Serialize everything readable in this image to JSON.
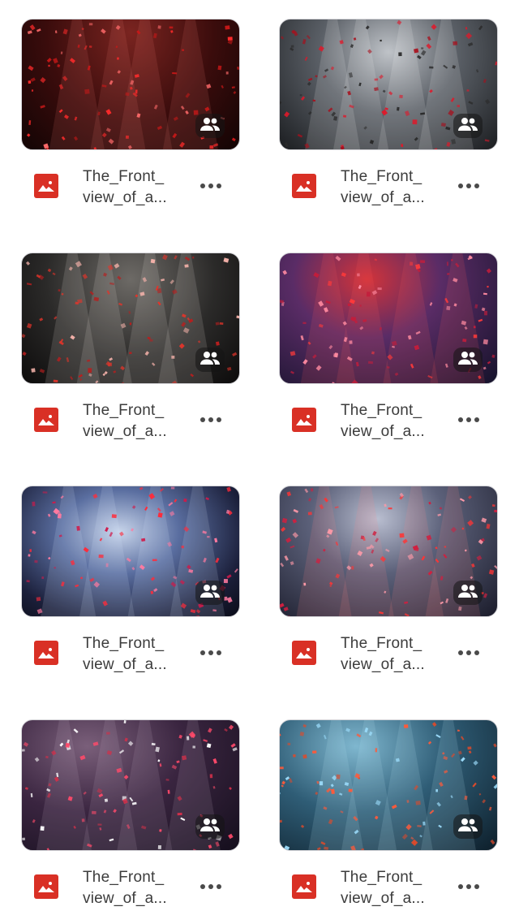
{
  "files": [
    {
      "name_line1": "The_Front_",
      "name_line2": "view_of_a...",
      "file_type_icon": "image-icon",
      "shared_icon": "people-icon",
      "more_icon": "more-horizontal-icon",
      "thumb_bg": "radial-gradient(ellipse at 50% 10%, #7a2420 0%, #3a0c0c 55%, #120404 100%)",
      "beam": "#e87a70",
      "confetti": [
        "#ff2b2b",
        "#c81818",
        "#ff6a6a"
      ]
    },
    {
      "name_line1": "The_Front_",
      "name_line2": "view_of_a...",
      "file_type_icon": "image-icon",
      "shared_icon": "people-icon",
      "more_icon": "more-horizontal-icon",
      "thumb_bg": "radial-gradient(ellipse at 50% 25%, #bfc3c8 0%, #5a5f66 45%, #1b1d20 100%)",
      "beam": "#ffffff",
      "confetti": [
        "#e0182a",
        "#a80f1c",
        "#2a2a2a"
      ]
    },
    {
      "name_line1": "The_Front_",
      "name_line2": "view_of_a...",
      "file_type_icon": "image-icon",
      "shared_icon": "people-icon",
      "more_icon": "more-horizontal-icon",
      "thumb_bg": "radial-gradient(ellipse at 50% 20%, #6d6a66 0%, #2b2a29 55%, #0c0b0b 100%)",
      "beam": "#f4ede5",
      "confetti": [
        "#e3342a",
        "#b81e1e",
        "#f2b0a8"
      ]
    },
    {
      "name_line1": "The_Front_",
      "name_line2": "view_of_a...",
      "file_type_icon": "image-icon",
      "shared_icon": "people-icon",
      "more_icon": "more-horizontal-icon",
      "thumb_bg": "radial-gradient(ellipse at 40% 20%, #d2333a 0%, #5a2c66 40%, #14122a 100%)",
      "beam": "#ff5a5a",
      "confetti": [
        "#ff3a3a",
        "#c41d3b",
        "#ff8aa0"
      ]
    },
    {
      "name_line1": "The_Front_",
      "name_line2": "view_of_a...",
      "file_type_icon": "image-icon",
      "shared_icon": "people-icon",
      "more_icon": "more-horizontal-icon",
      "thumb_bg": "radial-gradient(ellipse at 45% 35%, #c7d4ea 0%, #5a6ea0 35%, #1b1f3a 75%, #0b0c18 100%)",
      "beam": "#dce8ff",
      "confetti": [
        "#ff2b3a",
        "#d01a4a",
        "#ff7aa0"
      ]
    },
    {
      "name_line1": "The_Front_",
      "name_line2": "view_of_a...",
      "file_type_icon": "image-icon",
      "shared_icon": "people-icon",
      "more_icon": "more-horizontal-icon",
      "thumb_bg": "radial-gradient(ellipse at 45% 25%, #b9bed0 0%, #5b6079 40%, #1a1b2a 100%)",
      "beam": "#ff8a8a",
      "confetti": [
        "#ff3434",
        "#d02040",
        "#ff9aa8"
      ]
    },
    {
      "name_line1": "The_Front_",
      "name_line2": "view_of_a...",
      "file_type_icon": "image-icon",
      "shared_icon": "people-icon",
      "more_icon": "more-horizontal-icon",
      "thumb_bg": "radial-gradient(ellipse at 30% 20%, #7a5f7a 0%, #3a2540 45%, #140e1c 100%)",
      "beam": "#c8b0c8",
      "confetti": [
        "#ff4a6a",
        "#d0304a",
        "#ffffff"
      ]
    },
    {
      "name_line1": "The_Front_",
      "name_line2": "view_of_a...",
      "file_type_icon": "image-icon",
      "shared_icon": "people-icon",
      "more_icon": "more-horizontal-icon",
      "thumb_bg": "radial-gradient(ellipse at 35% 20%, #7fb7cf 0%, #2f5d76 45%, #0d1e2a 100%)",
      "beam": "#bfe8f6",
      "confetti": [
        "#ff5a3a",
        "#e04a2a",
        "#9fe0ff"
      ]
    }
  ],
  "colors": {
    "file_icon_bg": "#d93025",
    "text": "#3c3c3c",
    "border": "#d4d4d8"
  }
}
